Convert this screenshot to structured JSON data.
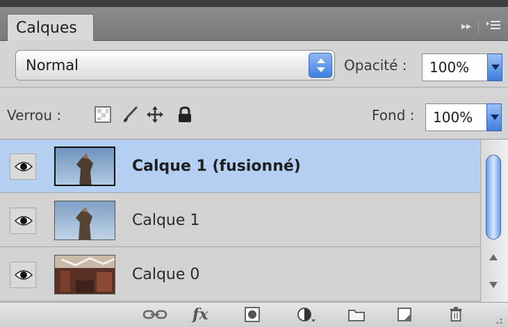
{
  "panel": {
    "tab_label": "Calques",
    "menu_icons": [
      "double-arrow-icon",
      "panel-menu-icon"
    ]
  },
  "blend": {
    "mode": "Normal",
    "opacity_label": "Opacité :",
    "opacity_value": "100%"
  },
  "lock": {
    "label": "Verrou :",
    "icons": [
      "lock-transparent-icon",
      "lock-paint-icon",
      "lock-move-icon",
      "lock-all-icon"
    ],
    "fill_label": "Fond :",
    "fill_value": "100%"
  },
  "layers": [
    {
      "name": "Calque 1 (fusionné)",
      "selected": true,
      "visible": true
    },
    {
      "name": "Calque 1",
      "selected": false,
      "visible": true
    },
    {
      "name": "Calque 0",
      "selected": false,
      "visible": true
    }
  ],
  "toolbar": {
    "icons": [
      "link-layers-icon",
      "fx-icon",
      "layer-mask-icon",
      "adjustment-layer-icon",
      "new-group-icon",
      "new-layer-icon",
      "trash-icon"
    ],
    "fx_label": "fx"
  }
}
